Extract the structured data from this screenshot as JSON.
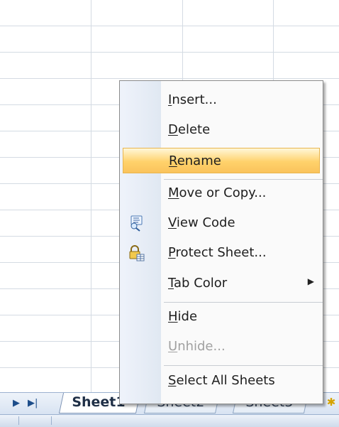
{
  "menu": {
    "items": [
      {
        "label": "Insert...",
        "mnemonic": "I",
        "rest": "nsert...",
        "state": "normal"
      },
      {
        "label": "Delete",
        "mnemonic": "D",
        "rest": "elete",
        "state": "normal"
      },
      {
        "label": "Rename",
        "mnemonic": "R",
        "rest": "ename",
        "state": "highlighted"
      },
      {
        "label": "Move or Copy...",
        "mnemonic": "M",
        "rest": "ove or Copy...",
        "state": "normal"
      },
      {
        "label": "View Code",
        "mnemonic": "V",
        "rest": "iew Code",
        "state": "normal",
        "icon": "view-code-icon"
      },
      {
        "label": "Protect Sheet...",
        "mnemonic": "P",
        "rest": "rotect Sheet...",
        "state": "normal",
        "icon": "protect-sheet-icon"
      },
      {
        "label": "Tab Color",
        "mnemonic": "T",
        "rest": "ab Color",
        "state": "normal",
        "submenu_indicator": "▶"
      },
      {
        "label": "Hide",
        "mnemonic": "H",
        "rest": "ide",
        "state": "normal"
      },
      {
        "label": "Unhide...",
        "mnemonic": "U",
        "rest": "nhide...",
        "state": "disabled"
      },
      {
        "label": "Select All Sheets",
        "mnemonic": "S",
        "rest": "elect All Sheets",
        "state": "normal"
      }
    ]
  },
  "tabs": {
    "navigation": [
      "▶",
      "▶|"
    ],
    "sheets": [
      "Sheet1",
      "Sheet2",
      "Sheet3"
    ],
    "active": "Sheet1",
    "new_sheet_icon": "insert-worksheet-icon"
  },
  "colors": {
    "gridline": "#d4dbe3",
    "menu_highlight": "#ffd26b",
    "menu_border": "#8b8b8b",
    "disabled_text": "#a1a1a1"
  }
}
